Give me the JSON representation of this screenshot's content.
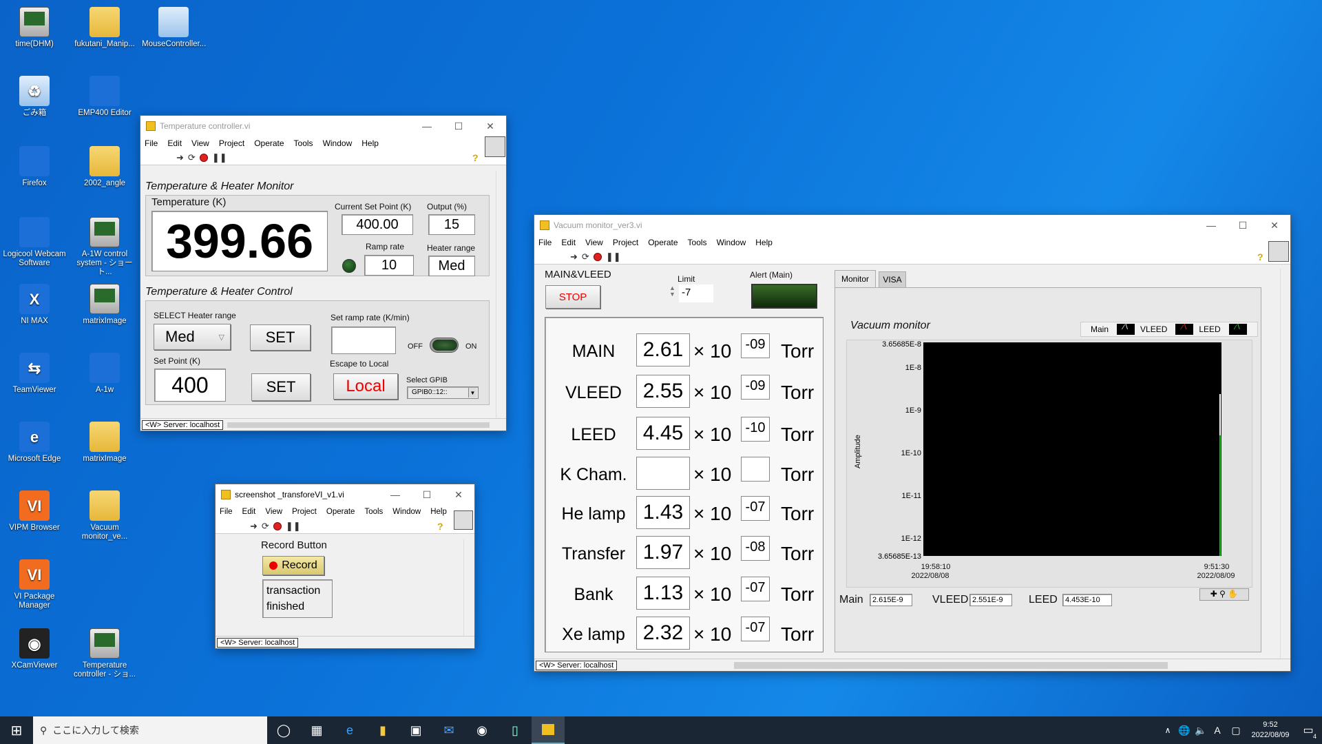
{
  "desktop": {
    "icons": [
      {
        "label": "time(DHM)"
      },
      {
        "label": "fukutani_Manip..."
      },
      {
        "label": "MouseController..."
      },
      {
        "label": "ごみ箱"
      },
      {
        "label": "EMP400 Editor"
      },
      {
        "label": "Firefox"
      },
      {
        "label": "2002_angle"
      },
      {
        "label": "Logicool Webcam Software"
      },
      {
        "label": "A-1W control system - ショート..."
      },
      {
        "label": "NI MAX"
      },
      {
        "label": "matrixImage"
      },
      {
        "label": "TeamViewer"
      },
      {
        "label": "A-1w"
      },
      {
        "label": "Microsoft Edge"
      },
      {
        "label": "matrixImage"
      },
      {
        "label": "VIPM Browser"
      },
      {
        "label": "Vacuum monitor_ve..."
      },
      {
        "label": "VI Package Manager"
      },
      {
        "label": "XCamViewer"
      },
      {
        "label": "Temperature controller - ショ..."
      }
    ]
  },
  "menu": [
    "File",
    "Edit",
    "View",
    "Project",
    "Operate",
    "Tools",
    "Window",
    "Help"
  ],
  "server_status": "<W> Server: localhost",
  "temp_window": {
    "title": "Temperature controller.vi",
    "monitor_title": "Temperature & Heater Monitor",
    "temperature_label": "Temperature (K)",
    "temperature_value": "399.66",
    "current_setpoint_label": "Current Set Point (K)",
    "current_setpoint_value": "400.00",
    "output_label": "Output (%)",
    "output_value": "15",
    "ramp_rate_label": "Ramp rate",
    "ramp_rate_value": "10",
    "heater_range_label": "Heater range",
    "heater_range_value": "Med",
    "control_title": "Temperature & Heater Control",
    "select_heater_label": "SELECT Heater range",
    "select_heater_value": "Med",
    "set_label": "SET",
    "set_ramp_label": "Set ramp rate (K/min)",
    "set_ramp_value": "",
    "off_label": "OFF",
    "on_label": "ON",
    "set_point_label": "Set Point (K)",
    "set_point_value": "400",
    "escape_label": "Escape to Local",
    "local_label": "Local",
    "select_gpib_label": "Select GPIB",
    "gpib_value": "GPIB0::12::"
  },
  "screenshot_window": {
    "title": "screenshot _transforeVI_v1.vi",
    "record_heading": "Record Button",
    "record_label": "Record",
    "status_text": "transaction finished"
  },
  "vacuum_window": {
    "title": "Vacuum monitor_ver3.vi",
    "main_vleed_label": "MAIN&VLEED",
    "stop_label": "STOP",
    "limit_label": "Limit",
    "limit_value": "-7",
    "alert_label": "Alert (Main)",
    "times_ten": "× 10",
    "unit": "Torr",
    "rows": [
      {
        "name": "MAIN",
        "value": "2.61",
        "exp": "-09"
      },
      {
        "name": "VLEED",
        "value": "2.55",
        "exp": "-09"
      },
      {
        "name": "LEED",
        "value": "4.45",
        "exp": "-10"
      },
      {
        "name": "K Cham.",
        "value": "",
        "exp": ""
      },
      {
        "name": "He lamp",
        "value": "1.43",
        "exp": "-07"
      },
      {
        "name": "Transfer",
        "value": "1.97",
        "exp": "-08"
      },
      {
        "name": "Bank",
        "value": "1.13",
        "exp": "-07"
      },
      {
        "name": "Xe lamp",
        "value": "2.32",
        "exp": "-07"
      }
    ],
    "tabs": [
      "Monitor",
      "VISA"
    ],
    "graph_title": "Vacuum monitor",
    "legend": [
      "Main",
      "VLEED",
      "LEED"
    ],
    "y_axis_label": "Amplitude",
    "y_ticks": [
      "3.65685E-8",
      "1E-8",
      "1E-9",
      "1E-10",
      "1E-11",
      "1E-12",
      "3.65685E-13"
    ],
    "x_start": {
      "time": "19:58:10",
      "date": "2022/08/08"
    },
    "x_end": {
      "time": "9:51:30",
      "date": "2022/08/09"
    },
    "readouts": [
      {
        "label": "Main",
        "value": "2.615E-9"
      },
      {
        "label": "VLEED",
        "value": "2.551E-9"
      },
      {
        "label": "LEED",
        "value": "4.453E-10"
      }
    ]
  },
  "taskbar": {
    "search_placeholder": "ここに入力して検索",
    "time": "9:52",
    "date": "2022/08/09",
    "ime": "A",
    "notification_count": "4"
  }
}
